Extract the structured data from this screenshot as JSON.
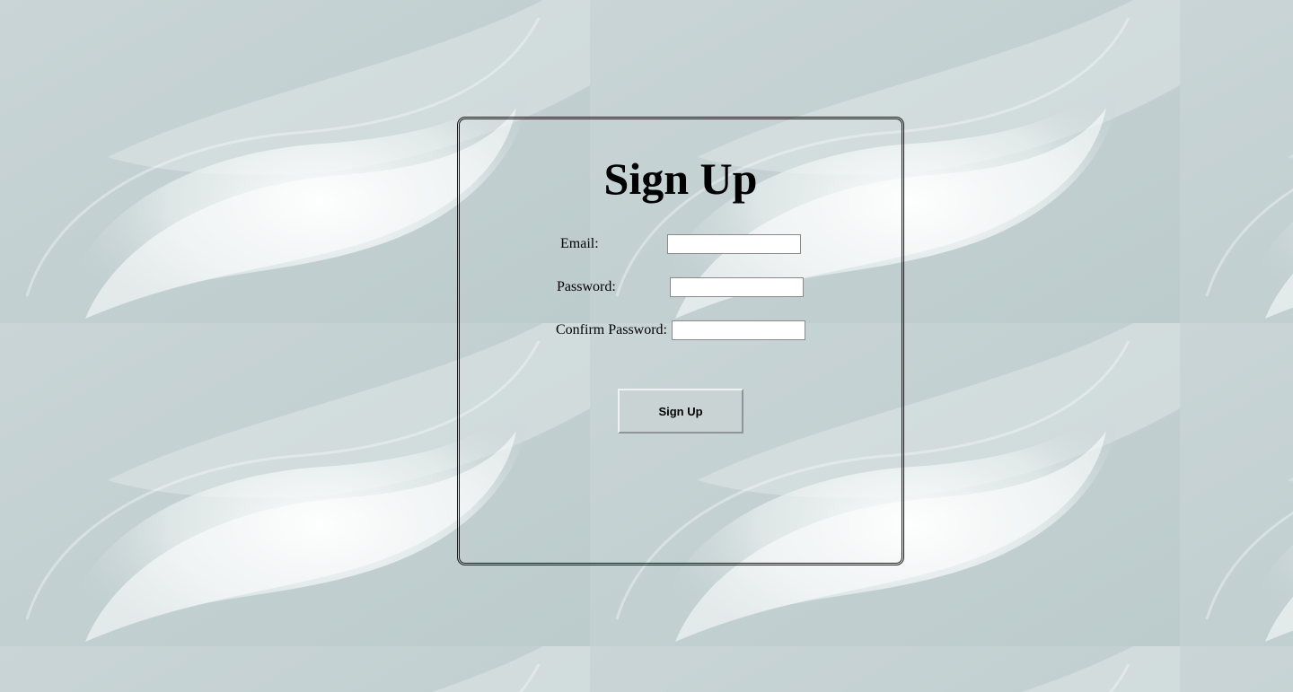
{
  "page": {
    "background_color": "#c3d0d1"
  },
  "signup": {
    "title": "Sign Up",
    "email_label": "Email:",
    "email_value": "",
    "password_label": "Password:",
    "password_value": "",
    "confirm_label": "Confirm Password:",
    "confirm_value": "",
    "submit_label": "Sign Up"
  }
}
